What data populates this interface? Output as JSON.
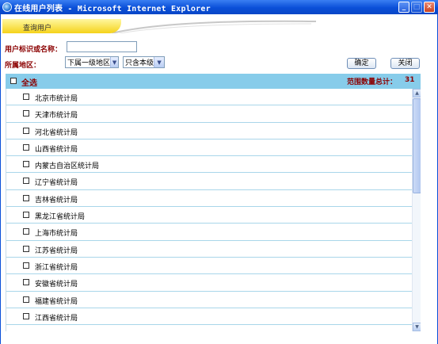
{
  "window": {
    "title": "在线用户列表 - Microsoft Internet Explorer"
  },
  "tab": {
    "label": "查询用户"
  },
  "form": {
    "user_label": "用户标识或名称：",
    "user_value": "",
    "region_label": "所属地区：",
    "region_select": "下属一级地区",
    "scope_select": "只含本级",
    "confirm_label": "确定",
    "close_label": "关闭"
  },
  "list": {
    "select_all_label": "全选",
    "count_label": "范围数量总计：",
    "count_value": "31",
    "items": [
      "北京市统计局",
      "天津市统计局",
      "河北省统计局",
      "山西省统计局",
      "内蒙古自治区统计局",
      "辽宁省统计局",
      "吉林省统计局",
      "黑龙江省统计局",
      "上海市统计局",
      "江苏省统计局",
      "浙江省统计局",
      "安徽省统计局",
      "福建省统计局",
      "江西省统计局"
    ]
  },
  "colors": {
    "titlebar": "#0a4fd8",
    "header_bg": "#87ccea",
    "label_red": "#8b0000",
    "tab_yellow": "#f5d21a"
  }
}
